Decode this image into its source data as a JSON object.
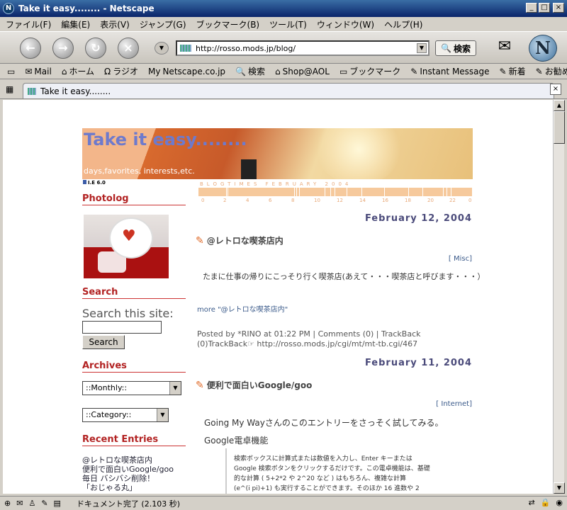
{
  "window": {
    "title": "Take it easy........ - Netscape"
  },
  "menu": [
    "ファイル(F)",
    "編集(E)",
    "表示(V)",
    "ジャンプ(G)",
    "ブックマーク(B)",
    "ツール(T)",
    "ウィンドウ(W)",
    "ヘルプ(H)"
  ],
  "nav": {
    "url": "http://rosso.mods.jp/blog/",
    "search_label": "検索"
  },
  "personal_bar": [
    "Mail",
    "ホーム",
    "ラジオ",
    "Netscape.co.jp",
    "検索",
    "Shop@AOL",
    "ブックマーク",
    "Instant Message",
    "新着",
    "お勧め"
  ],
  "tab": {
    "label": "Take it easy........"
  },
  "status": {
    "text": "ドキュメント完了 (2.103 秒)"
  },
  "blog": {
    "title": "Take it easy........",
    "subtitle": "days,favorites, interests,etc.",
    "ie_note": "I.E 6.0",
    "blogtimes": {
      "label": "BLOGTIMES  FEBRUARY 2004",
      "axis": [
        "0",
        "2",
        "4",
        "6",
        "8",
        "10",
        "12",
        "14",
        "16",
        "18",
        "20",
        "22",
        "0"
      ]
    },
    "sidebar": {
      "photolog_heading": "Photolog",
      "search_heading": "Search",
      "search_label": "Search this site:",
      "search_value": "",
      "search_button": "Search",
      "archives_heading": "Archives",
      "monthly_select": "::Monthly::",
      "category_select": "::Category::",
      "recent_heading": "Recent Entries",
      "recent_entries": [
        "@レトロな喫茶店内",
        "便利で面白いGoogle/goo",
        "毎日 バシバシ削除！",
        "「おじゃる丸」"
      ]
    },
    "posts": [
      {
        "date": "February 12, 2004",
        "title": "@レトロな喫茶店内",
        "category": "[ Misc]",
        "body": "たまに仕事の帰りにこっそり行く喫茶店(あえて・・・喫茶店と呼びます・・・）",
        "more": "more \"@レトロな喫茶店内\"",
        "posted_by": "Posted by *RINO at 01:22 PM | Comments (0) | TrackBack",
        "trackback": "(0)TrackBack☞ http://rosso.mods.jp/cgi/mt/mt-tb.cgi/467"
      },
      {
        "date": "February 11, 2004",
        "title": "便利で面白いGoogle/goo",
        "category": "[ Internet]",
        "body": "Going My Wayさんのこのエントリーをさっそく試してみる。",
        "body2": "Google電卓機能",
        "quote": [
          "検索ボックスに計算式または数値を入力し、Enter キーまたは",
          "Google 検索ボタンをクリックするだけです。この電卓機能は、基礎",
          "的な計算 ( 5+2*2 や 2^20 など ) はもちろん、複雑な計算",
          "(e^(i pi)+1) も実行することができます。そのほか 16 進数や 2"
        ]
      }
    ]
  }
}
